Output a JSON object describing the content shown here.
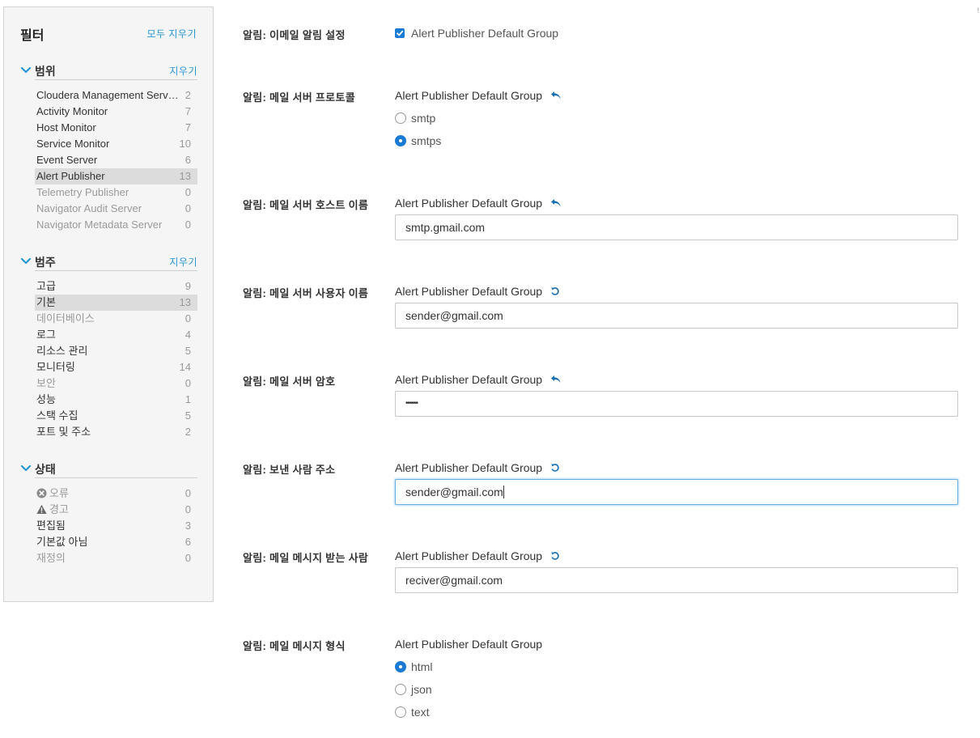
{
  "sidebar": {
    "title": "필터",
    "clear_all": "모두 지우기",
    "sections": {
      "scope": {
        "title": "범위",
        "clear": "지우기",
        "items": [
          {
            "label": "Cloudera Management Servi...",
            "count": "2"
          },
          {
            "label": "Activity Monitor",
            "count": "7"
          },
          {
            "label": "Host Monitor",
            "count": "7"
          },
          {
            "label": "Service Monitor",
            "count": "10"
          },
          {
            "label": "Event Server",
            "count": "6"
          },
          {
            "label": "Alert Publisher",
            "count": "13"
          },
          {
            "label": "Telemetry Publisher",
            "count": "0"
          },
          {
            "label": "Navigator Audit Server",
            "count": "0"
          },
          {
            "label": "Navigator Metadata Server",
            "count": "0"
          }
        ]
      },
      "category": {
        "title": "범주",
        "clear": "지우기",
        "items": [
          {
            "label": "고급",
            "count": "9"
          },
          {
            "label": "기본",
            "count": "13"
          },
          {
            "label": "데이터베이스",
            "count": "0"
          },
          {
            "label": "로그",
            "count": "4"
          },
          {
            "label": "리소스 관리",
            "count": "5"
          },
          {
            "label": "모니터링",
            "count": "14"
          },
          {
            "label": "보안",
            "count": "0"
          },
          {
            "label": "성능",
            "count": "1"
          },
          {
            "label": "스택 수집",
            "count": "5"
          },
          {
            "label": "포트 및 주소",
            "count": "2"
          }
        ]
      },
      "status": {
        "title": "상태",
        "items": [
          {
            "label": "오류",
            "count": "0"
          },
          {
            "label": "경고",
            "count": "0"
          },
          {
            "label": "편집됨",
            "count": "3"
          },
          {
            "label": "기본값 아님",
            "count": "6"
          },
          {
            "label": "재정의",
            "count": "0"
          }
        ]
      }
    }
  },
  "main": {
    "corner_mark": "!",
    "settings": {
      "email_alerts": {
        "label": "알림: 이메일 알림 설정",
        "option": "Alert Publisher Default Group",
        "checked": true
      },
      "protocol": {
        "label": "알림: 메일 서버 프로토콜",
        "group": "Alert Publisher Default Group",
        "options": [
          "smtp",
          "smtps"
        ],
        "selected": "smtps"
      },
      "host": {
        "label": "알림: 메일 서버 호스트 이름",
        "group": "Alert Publisher Default Group",
        "value": "smtp.gmail.com"
      },
      "username": {
        "label": "알림: 메일 서버 사용자 이름",
        "group": "Alert Publisher Default Group",
        "value": "sender@gmail.com"
      },
      "password": {
        "label": "알림: 메일 서버 암호",
        "group": "Alert Publisher Default Group",
        "value": "••••••"
      },
      "sender": {
        "label": "알림: 보낸 사람 주소",
        "group": "Alert Publisher Default Group",
        "value": "sender@gmail.com"
      },
      "recipients": {
        "label": "알림: 메일 메시지 받는 사람",
        "group": "Alert Publisher Default Group",
        "value": "reciver@gmail.com"
      },
      "format": {
        "label": "알림: 메일 메시지 형식",
        "group": "Alert Publisher Default Group",
        "options": [
          "html",
          "json",
          "text"
        ],
        "selected": "html"
      }
    }
  },
  "colors": {
    "accent": "#1a7ad4",
    "link": "#2a96d4",
    "sidebar_bg": "#f5f5f5",
    "selected_bg": "#dcdcdc"
  }
}
